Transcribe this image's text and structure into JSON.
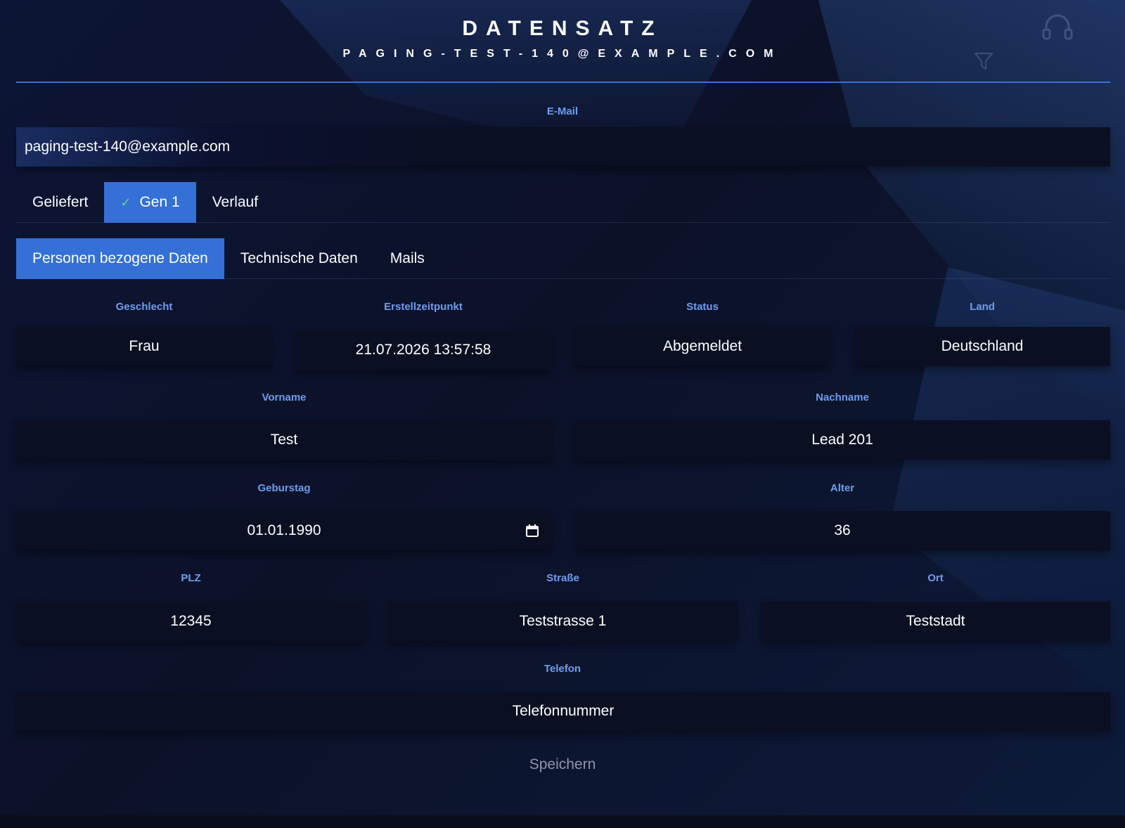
{
  "header": {
    "title": "DATENSATZ",
    "subtitle": "PAGING-TEST-140@EXAMPLE.COM",
    "icons": [
      "headset-icon",
      "filter-icon"
    ]
  },
  "email": {
    "label": "E-Mail",
    "value": "paging-test-140@example.com"
  },
  "status_tabs": [
    {
      "label": "Geliefert",
      "active": false
    },
    {
      "label": "Gen 1",
      "active": true,
      "icon": "check-icon"
    },
    {
      "label": "Verlauf",
      "active": false
    }
  ],
  "section_tabs": [
    {
      "label": "Personen bezogene Daten",
      "active": true
    },
    {
      "label": "Technische Daten",
      "active": false
    },
    {
      "label": "Mails",
      "active": false
    }
  ],
  "fields": {
    "geschlecht": {
      "label": "Geschlecht",
      "value": "Frau"
    },
    "erstellzeitpunkt": {
      "label": "Erstellzeitpunkt",
      "value": "21.07.2026 13:57:58"
    },
    "status": {
      "label": "Status",
      "value": "Abgemeldet"
    },
    "land": {
      "label": "Land",
      "value": "Deutschland"
    },
    "vorname": {
      "label": "Vorname",
      "value": "Test"
    },
    "nachname": {
      "label": "Nachname",
      "value": "Lead 201"
    },
    "geburtstag": {
      "label": "Geburstag",
      "value": "01.01.1990"
    },
    "alter": {
      "label": "Alter",
      "value": "36"
    },
    "plz": {
      "label": "PLZ",
      "value": "12345"
    },
    "strasse": {
      "label": "Straße",
      "value": "Teststrasse 1"
    },
    "ort": {
      "label": "Ort",
      "value": "Teststadt"
    },
    "telefon": {
      "label": "Telefon",
      "value": "Telefonnummer"
    }
  },
  "actions": {
    "save_label": "Speichern"
  },
  "colors": {
    "accent": "#3470d6",
    "label": "#6f9df0",
    "background": "#0b1022",
    "field": "#0a0f22",
    "check": "#5fd38a"
  }
}
